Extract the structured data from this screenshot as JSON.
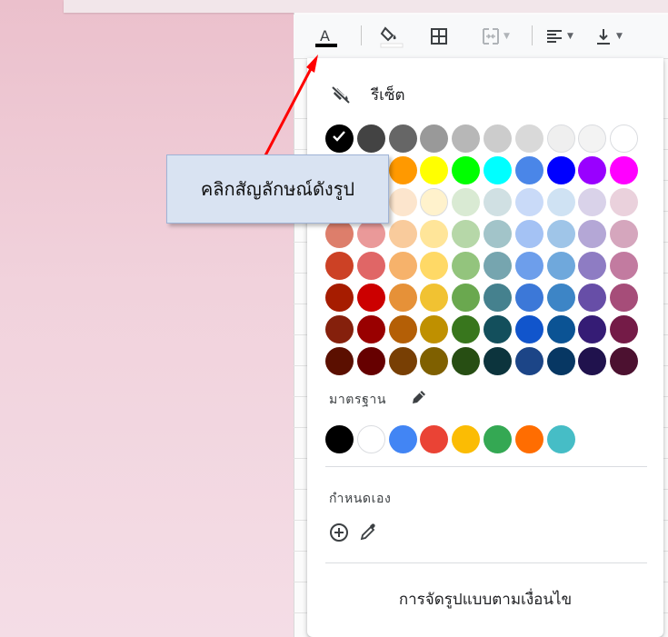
{
  "callout": {
    "text": "คลิกสัญลักษณ์ดังรูป"
  },
  "toolbar": {
    "items": [
      {
        "name": "text-color-button",
        "icon": "text-color-icon",
        "glyph": "A",
        "underline": "#000000"
      },
      {
        "name": "fill-color-button",
        "icon": "paint-bucket-icon"
      },
      {
        "name": "borders-button",
        "icon": "borders-icon"
      },
      {
        "name": "merge-cells-button",
        "icon": "merge-cells-icon"
      },
      {
        "name": "align-button",
        "icon": "align-left-icon"
      },
      {
        "name": "valign-button",
        "icon": "align-bottom-icon"
      }
    ]
  },
  "menu": {
    "reset_label": "รีเซ็ต",
    "standard_label": "มาตรฐาน",
    "custom_label": "กำหนดเอง",
    "conditional_formatting_label": "การจัดรูปแบบตามเงื่อนไข",
    "palette": [
      [
        "#000000",
        "#434343",
        "#666666",
        "#999999",
        "#b7b7b7",
        "#cccccc",
        "#d9d9d9",
        "#efefef",
        "#f3f3f3",
        "#ffffff"
      ],
      [
        "#980000",
        "#ff0000",
        "#ff9900",
        "#ffff00",
        "#00ff00",
        "#00ffff",
        "#4a86e8",
        "#0000ff",
        "#9900ff",
        "#ff00ff"
      ],
      [
        "#e6b8af",
        "#f4cccc",
        "#fce5cd",
        "#fff2cc",
        "#d9ead3",
        "#d0e0e3",
        "#c9daf8",
        "#cfe2f3",
        "#d9d2e9",
        "#ead1dc"
      ],
      [
        "#dd7e6b",
        "#ea9999",
        "#f9cb9c",
        "#ffe599",
        "#b6d7a8",
        "#a2c4c9",
        "#a4c2f4",
        "#9fc5e8",
        "#b4a7d6",
        "#d5a6bd"
      ],
      [
        "#cc4125",
        "#e06666",
        "#f6b26b",
        "#ffd966",
        "#93c47d",
        "#76a5af",
        "#6d9eeb",
        "#6fa8dc",
        "#8e7cc3",
        "#c27ba0"
      ],
      [
        "#a61c00",
        "#cc0000",
        "#e69138",
        "#f1c232",
        "#6aa84f",
        "#45818e",
        "#3c78d8",
        "#3d85c6",
        "#674ea7",
        "#a64d79"
      ],
      [
        "#85200c",
        "#990000",
        "#b45f06",
        "#bf9000",
        "#38761d",
        "#134f5c",
        "#1155cc",
        "#0b5394",
        "#351c75",
        "#741b47"
      ],
      [
        "#5b0f00",
        "#660000",
        "#783f04",
        "#7f6000",
        "#274e13",
        "#0c343d",
        "#1c4587",
        "#073763",
        "#20124d",
        "#4c1130"
      ]
    ],
    "selected": "#000000",
    "standard_colors": [
      "#000000",
      "#ffffff",
      "#4285f4",
      "#ea4335",
      "#fbbc04",
      "#34a853",
      "#ff6d01",
      "#46bdc6"
    ]
  }
}
